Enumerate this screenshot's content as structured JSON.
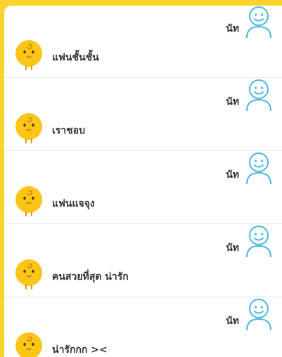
{
  "user": {
    "name": "นัท"
  },
  "messages": [
    {
      "user_text": "นัท",
      "bot_text": "แฟนชั้นชั้น"
    },
    {
      "user_text": "นัท",
      "bot_text": "เราชอบ"
    },
    {
      "user_text": "นัท",
      "bot_text": "แฟนแจจุง"
    },
    {
      "user_text": "นัท",
      "bot_text": "คนสวยที่สุด น่ารัก"
    },
    {
      "user_text": "นัท",
      "bot_text": "น่ารักกก ><"
    }
  ],
  "colors": {
    "background": "#fcd32a",
    "panel": "#ffffff",
    "divider": "#e6e6e6",
    "user_avatar": "#4ab8e0",
    "bot_avatar": "#fcc517"
  },
  "icons": {
    "user_avatar": "person-outline-icon",
    "bot_avatar": "yellow-chick-icon"
  }
}
